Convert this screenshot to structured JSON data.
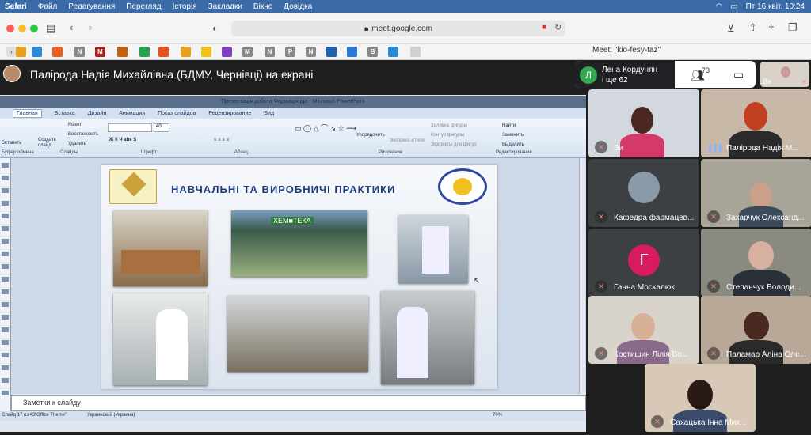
{
  "menubar": {
    "app": "Safari",
    "items": [
      "Файл",
      "Редагування",
      "Перегляд",
      "Історія",
      "Закладки",
      "Вікно",
      "Довідка"
    ],
    "clock": "Пт 16 квіт.  10:24"
  },
  "browser": {
    "url": "meet.google.com",
    "tab_title": "Meet: \"kio-fesy-taz\"",
    "fav_letters": [
      "N",
      "M",
      "N",
      "M",
      "N",
      "P",
      "W",
      "B"
    ]
  },
  "meet": {
    "presenter_title": "Палірода Надія Михайлівна (БДМУ, Чернівці) на екрані",
    "people": {
      "avatar_letter": "Л",
      "line1": "Лена Кордунян",
      "line2": "і ще 62",
      "count": "73"
    },
    "self_label": "Ви",
    "participants": [
      {
        "name": "Ви",
        "muted": true
      },
      {
        "name": "Палірода Надія М...",
        "muted": false
      },
      {
        "name": "Кафедра фармацев...",
        "muted": true
      },
      {
        "name": "Захарчук Олександ...",
        "muted": true
      },
      {
        "name": "Ганна Москалюк",
        "muted": true,
        "letter": "Г"
      },
      {
        "name": "Степанчук Володи...",
        "muted": true
      },
      {
        "name": "Костишин Лілія Во...",
        "muted": true
      },
      {
        "name": "Паламар Аліна Оле...",
        "muted": true
      },
      {
        "name": "Сахацька Інна Мих...",
        "muted": true
      }
    ]
  },
  "powerpoint": {
    "title": "Презентація робота Фармація.ppt - Microsoft PowerPoint",
    "tabs": [
      "Главная",
      "Вставка",
      "Дизайн",
      "Анимация",
      "Показ слайдов",
      "Рецензирование",
      "Вид"
    ],
    "ribbon": {
      "create_slide": "Создать слайд",
      "layout": "Макет",
      "restore": "Восстановить",
      "delete": "Удалить",
      "group_slides": "Слайды",
      "group_font": "Шрифт",
      "group_paragraph": "Абзац",
      "group_drawing": "Рисование",
      "group_editing": "Редактирование",
      "arrange": "Упорядочить",
      "quick_styles": "Экспресс-стили",
      "fill": "Заливка фигуры",
      "outline": "Контур фигуры",
      "effects": "Эффекты для фигур",
      "find": "Найти",
      "replace": "Заменить",
      "select": "Выделить",
      "paste": "Вставить",
      "clipboard": "Буфер обмена",
      "font_size": "40"
    },
    "slide_title": "НАВЧАЛЬНІ ТА ВИРОБНИЧІ ПРАКТИКИ",
    "photo_sign": "ХЕМ■ТЕКА",
    "notes": "Заметки к слайду",
    "status": {
      "slide": "Слайд 17 из 43",
      "theme": "\"Office Theme\"",
      "lang": "Украинский (Украина)",
      "zoom": "70%"
    }
  }
}
